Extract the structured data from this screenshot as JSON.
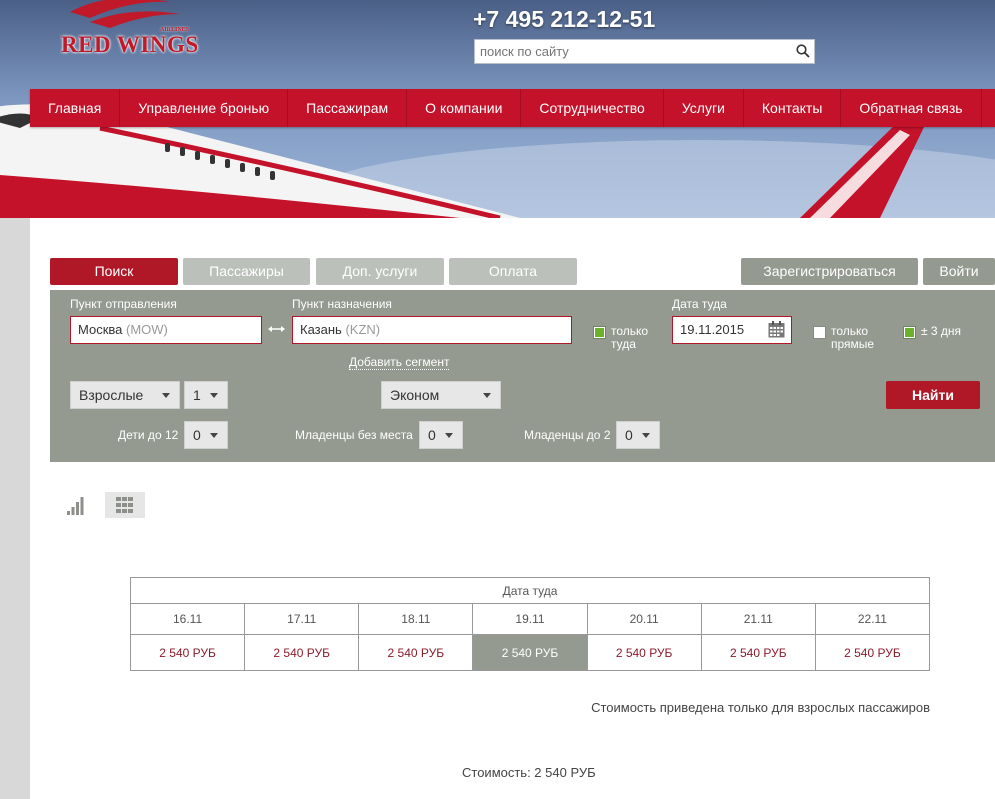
{
  "header": {
    "logo_text": "RED WINGS",
    "logo_sub": "AIRLINES",
    "phone": "+7 495 212-12-51",
    "search": {
      "placeholder": "поиск по сайту",
      "icon": "search-icon"
    }
  },
  "nav": [
    "Главная",
    "Управление бронью",
    "Пассажирам",
    "О компании",
    "Сотрудничество",
    "Услуги",
    "Контакты",
    "Обратная связь"
  ],
  "steps": {
    "search": "Поиск",
    "passengers": "Пассажиры",
    "extras": "Доп. услуги",
    "payment": "Оплата"
  },
  "auth": {
    "register": "Зарегистрироваться",
    "login": "Войти"
  },
  "form": {
    "origin_label": "Пункт отправления",
    "origin_city": "Москва",
    "origin_code": "(MOW)",
    "dest_label": "Пункт назначения",
    "dest_city": "Казань",
    "dest_code": "(KZN)",
    "one_way_label_1": "только",
    "one_way_label_2": "туда",
    "one_way_checked": true,
    "date_label": "Дата туда",
    "date_value": "19.11.2015",
    "direct_label_1": "только",
    "direct_label_2": "прямые",
    "direct_checked": false,
    "flex_label": "± 3 дня",
    "flex_checked": true,
    "add_segment": "Добавить сегмент",
    "adults_type": "Взрослые",
    "adults_count": "1",
    "class": "Эконом",
    "find": "Найти",
    "children_label": "Дети до 12",
    "children_count": "0",
    "infants_noseat_label": "Младенцы без места",
    "infants_noseat_count": "0",
    "infants_label": "Младенцы до 2",
    "infants_count": "0",
    "colors": {
      "brand_red": "#c4122a",
      "form_gray": "#959a91",
      "checkbox_green": "#6bb12a"
    }
  },
  "fare_table": {
    "header": "Дата туда",
    "dates": [
      "16.11",
      "17.11",
      "18.11",
      "19.11",
      "20.11",
      "21.11",
      "22.11"
    ],
    "prices": [
      "2 540 РУБ",
      "2 540 РУБ",
      "2 540 РУБ",
      "2 540 РУБ",
      "2 540 РУБ",
      "2 540 РУБ",
      "2 540 РУБ"
    ],
    "selected_index": 3
  },
  "note": "Стоимость приведена только для взрослых пассажиров",
  "total": "Стоимость: 2 540 РУБ"
}
